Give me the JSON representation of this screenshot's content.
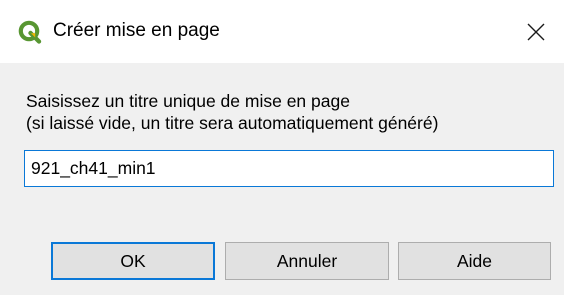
{
  "dialog": {
    "title": "Créer mise en page",
    "icon": "qgis-logo-icon",
    "close_icon": "close-icon"
  },
  "prompt": {
    "line1": "Saisissez un titre unique de mise en page",
    "line2": "(si laissé vide, un titre sera automatiquement généré)"
  },
  "title_input": {
    "value": "921_ch41_min1"
  },
  "buttons": {
    "ok": "OK",
    "cancel": "Annuler",
    "help": "Aide"
  },
  "colors": {
    "accent": "#0a78d7",
    "qgis_green": "#589632",
    "qgis_yellow": "#ee7913"
  }
}
